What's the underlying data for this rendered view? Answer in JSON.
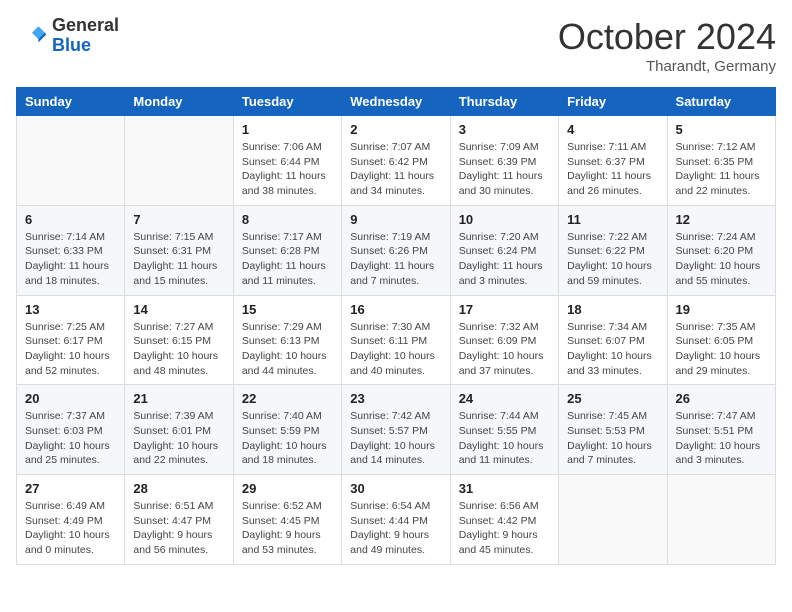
{
  "header": {
    "logo_general": "General",
    "logo_blue": "Blue",
    "month_title": "October 2024",
    "subtitle": "Tharandt, Germany"
  },
  "days_of_week": [
    "Sunday",
    "Monday",
    "Tuesday",
    "Wednesday",
    "Thursday",
    "Friday",
    "Saturday"
  ],
  "weeks": [
    [
      {
        "day": "",
        "sunrise": "",
        "sunset": "",
        "daylight": ""
      },
      {
        "day": "",
        "sunrise": "",
        "sunset": "",
        "daylight": ""
      },
      {
        "day": "1",
        "sunrise": "Sunrise: 7:06 AM",
        "sunset": "Sunset: 6:44 PM",
        "daylight": "Daylight: 11 hours and 38 minutes."
      },
      {
        "day": "2",
        "sunrise": "Sunrise: 7:07 AM",
        "sunset": "Sunset: 6:42 PM",
        "daylight": "Daylight: 11 hours and 34 minutes."
      },
      {
        "day": "3",
        "sunrise": "Sunrise: 7:09 AM",
        "sunset": "Sunset: 6:39 PM",
        "daylight": "Daylight: 11 hours and 30 minutes."
      },
      {
        "day": "4",
        "sunrise": "Sunrise: 7:11 AM",
        "sunset": "Sunset: 6:37 PM",
        "daylight": "Daylight: 11 hours and 26 minutes."
      },
      {
        "day": "5",
        "sunrise": "Sunrise: 7:12 AM",
        "sunset": "Sunset: 6:35 PM",
        "daylight": "Daylight: 11 hours and 22 minutes."
      }
    ],
    [
      {
        "day": "6",
        "sunrise": "Sunrise: 7:14 AM",
        "sunset": "Sunset: 6:33 PM",
        "daylight": "Daylight: 11 hours and 18 minutes."
      },
      {
        "day": "7",
        "sunrise": "Sunrise: 7:15 AM",
        "sunset": "Sunset: 6:31 PM",
        "daylight": "Daylight: 11 hours and 15 minutes."
      },
      {
        "day": "8",
        "sunrise": "Sunrise: 7:17 AM",
        "sunset": "Sunset: 6:28 PM",
        "daylight": "Daylight: 11 hours and 11 minutes."
      },
      {
        "day": "9",
        "sunrise": "Sunrise: 7:19 AM",
        "sunset": "Sunset: 6:26 PM",
        "daylight": "Daylight: 11 hours and 7 minutes."
      },
      {
        "day": "10",
        "sunrise": "Sunrise: 7:20 AM",
        "sunset": "Sunset: 6:24 PM",
        "daylight": "Daylight: 11 hours and 3 minutes."
      },
      {
        "day": "11",
        "sunrise": "Sunrise: 7:22 AM",
        "sunset": "Sunset: 6:22 PM",
        "daylight": "Daylight: 10 hours and 59 minutes."
      },
      {
        "day": "12",
        "sunrise": "Sunrise: 7:24 AM",
        "sunset": "Sunset: 6:20 PM",
        "daylight": "Daylight: 10 hours and 55 minutes."
      }
    ],
    [
      {
        "day": "13",
        "sunrise": "Sunrise: 7:25 AM",
        "sunset": "Sunset: 6:17 PM",
        "daylight": "Daylight: 10 hours and 52 minutes."
      },
      {
        "day": "14",
        "sunrise": "Sunrise: 7:27 AM",
        "sunset": "Sunset: 6:15 PM",
        "daylight": "Daylight: 10 hours and 48 minutes."
      },
      {
        "day": "15",
        "sunrise": "Sunrise: 7:29 AM",
        "sunset": "Sunset: 6:13 PM",
        "daylight": "Daylight: 10 hours and 44 minutes."
      },
      {
        "day": "16",
        "sunrise": "Sunrise: 7:30 AM",
        "sunset": "Sunset: 6:11 PM",
        "daylight": "Daylight: 10 hours and 40 minutes."
      },
      {
        "day": "17",
        "sunrise": "Sunrise: 7:32 AM",
        "sunset": "Sunset: 6:09 PM",
        "daylight": "Daylight: 10 hours and 37 minutes."
      },
      {
        "day": "18",
        "sunrise": "Sunrise: 7:34 AM",
        "sunset": "Sunset: 6:07 PM",
        "daylight": "Daylight: 10 hours and 33 minutes."
      },
      {
        "day": "19",
        "sunrise": "Sunrise: 7:35 AM",
        "sunset": "Sunset: 6:05 PM",
        "daylight": "Daylight: 10 hours and 29 minutes."
      }
    ],
    [
      {
        "day": "20",
        "sunrise": "Sunrise: 7:37 AM",
        "sunset": "Sunset: 6:03 PM",
        "daylight": "Daylight: 10 hours and 25 minutes."
      },
      {
        "day": "21",
        "sunrise": "Sunrise: 7:39 AM",
        "sunset": "Sunset: 6:01 PM",
        "daylight": "Daylight: 10 hours and 22 minutes."
      },
      {
        "day": "22",
        "sunrise": "Sunrise: 7:40 AM",
        "sunset": "Sunset: 5:59 PM",
        "daylight": "Daylight: 10 hours and 18 minutes."
      },
      {
        "day": "23",
        "sunrise": "Sunrise: 7:42 AM",
        "sunset": "Sunset: 5:57 PM",
        "daylight": "Daylight: 10 hours and 14 minutes."
      },
      {
        "day": "24",
        "sunrise": "Sunrise: 7:44 AM",
        "sunset": "Sunset: 5:55 PM",
        "daylight": "Daylight: 10 hours and 11 minutes."
      },
      {
        "day": "25",
        "sunrise": "Sunrise: 7:45 AM",
        "sunset": "Sunset: 5:53 PM",
        "daylight": "Daylight: 10 hours and 7 minutes."
      },
      {
        "day": "26",
        "sunrise": "Sunrise: 7:47 AM",
        "sunset": "Sunset: 5:51 PM",
        "daylight": "Daylight: 10 hours and 3 minutes."
      }
    ],
    [
      {
        "day": "27",
        "sunrise": "Sunrise: 6:49 AM",
        "sunset": "Sunset: 4:49 PM",
        "daylight": "Daylight: 10 hours and 0 minutes."
      },
      {
        "day": "28",
        "sunrise": "Sunrise: 6:51 AM",
        "sunset": "Sunset: 4:47 PM",
        "daylight": "Daylight: 9 hours and 56 minutes."
      },
      {
        "day": "29",
        "sunrise": "Sunrise: 6:52 AM",
        "sunset": "Sunset: 4:45 PM",
        "daylight": "Daylight: 9 hours and 53 minutes."
      },
      {
        "day": "30",
        "sunrise": "Sunrise: 6:54 AM",
        "sunset": "Sunset: 4:44 PM",
        "daylight": "Daylight: 9 hours and 49 minutes."
      },
      {
        "day": "31",
        "sunrise": "Sunrise: 6:56 AM",
        "sunset": "Sunset: 4:42 PM",
        "daylight": "Daylight: 9 hours and 45 minutes."
      },
      {
        "day": "",
        "sunrise": "",
        "sunset": "",
        "daylight": ""
      },
      {
        "day": "",
        "sunrise": "",
        "sunset": "",
        "daylight": ""
      }
    ]
  ]
}
